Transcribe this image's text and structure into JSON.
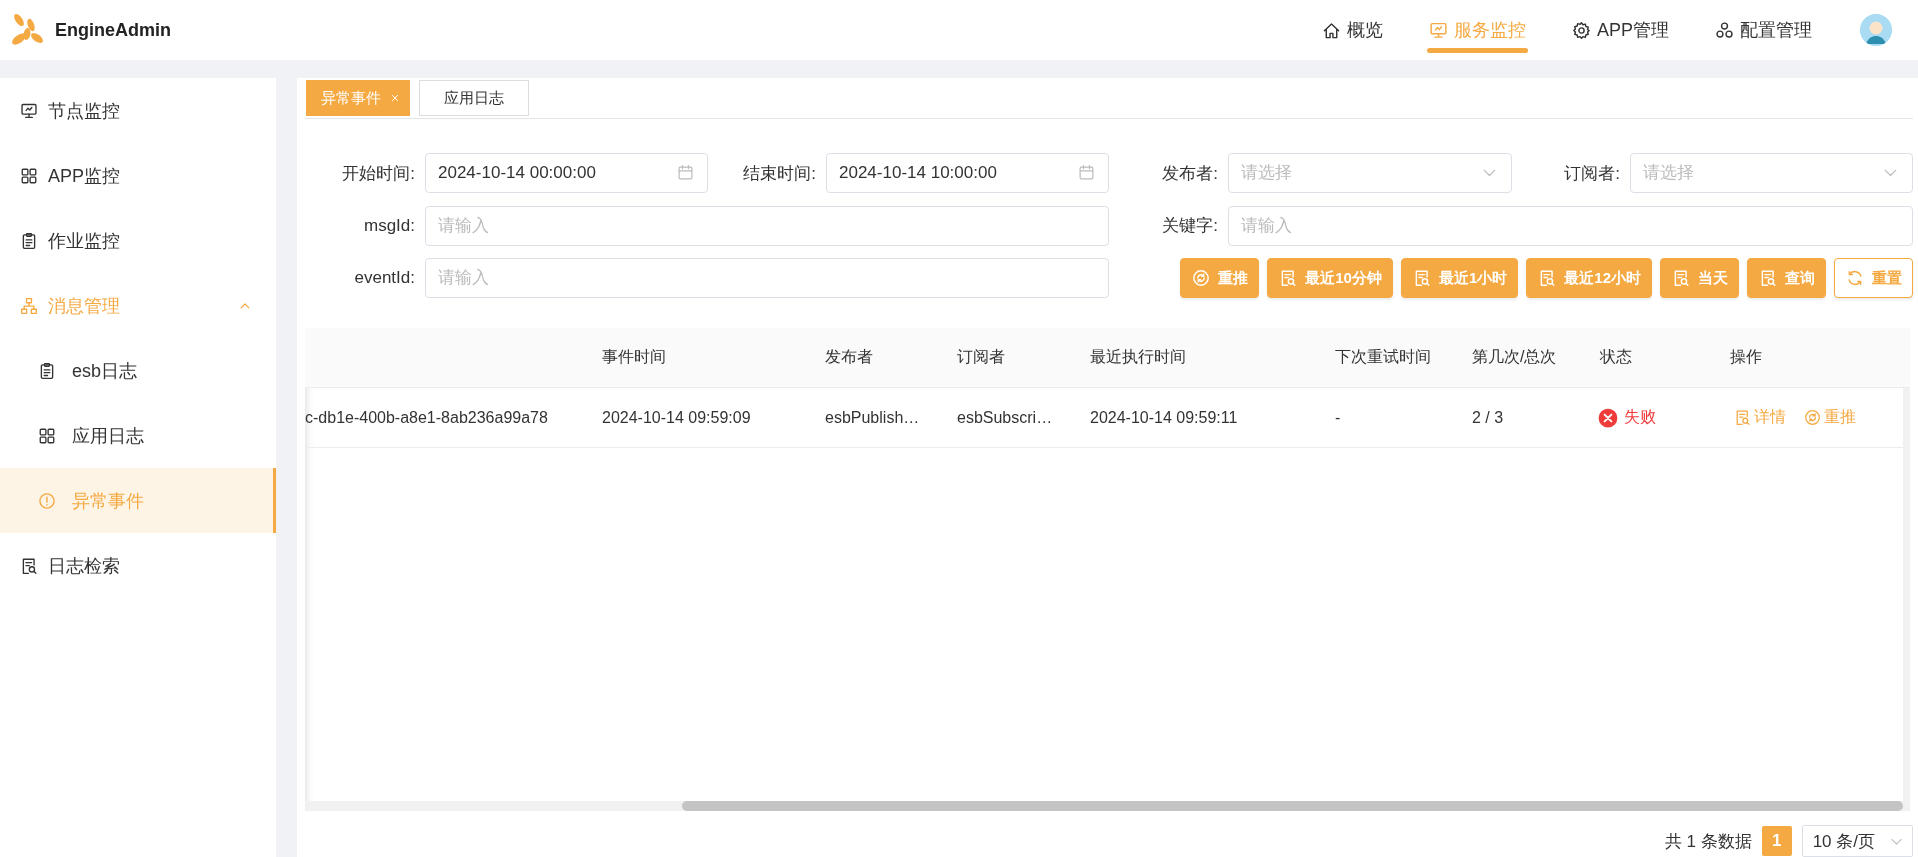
{
  "app": {
    "title": "EngineAdmin"
  },
  "nav": [
    {
      "label": "概览",
      "selected": false
    },
    {
      "label": "服务监控",
      "selected": true
    },
    {
      "label": "APP管理",
      "selected": false
    },
    {
      "label": "配置管理",
      "selected": false
    }
  ],
  "sidebar": {
    "items": [
      {
        "label": "节点监控",
        "selected": false
      },
      {
        "label": "APP监控",
        "selected": false
      },
      {
        "label": "作业监控",
        "selected": false
      },
      {
        "label": "消息管理",
        "expanded": true,
        "children": [
          {
            "label": "esb日志",
            "selected": false
          },
          {
            "label": "应用日志",
            "selected": false
          },
          {
            "label": "异常事件",
            "selected": true
          }
        ]
      },
      {
        "label": "日志检索",
        "selected": false
      }
    ]
  },
  "tabs": [
    {
      "label": "异常事件",
      "selected": true,
      "closable": true
    },
    {
      "label": "应用日志",
      "selected": false,
      "closable": false
    }
  ],
  "filters": [
    {
      "label": "开始时间:",
      "kind": "date",
      "value": "2024-10-14 00:00:00"
    },
    {
      "label": "结束时间:",
      "kind": "date",
      "value": "2024-10-14 10:00:00"
    },
    {
      "label": "发布者:",
      "kind": "select",
      "placeholder": "请选择"
    },
    {
      "label": "订阅者:",
      "kind": "select",
      "placeholder": "请选择"
    },
    {
      "label": "msgId:",
      "kind": "text",
      "placeholder": "请输入"
    },
    {
      "label": "关键字:",
      "kind": "text",
      "placeholder": "请输入"
    },
    {
      "label": "eventId:",
      "kind": "text",
      "placeholder": "请输入"
    }
  ],
  "buttons": [
    {
      "label": "重推",
      "kind": "primary"
    },
    {
      "label": "最近10分钟",
      "kind": "primary"
    },
    {
      "label": "最近1小时",
      "kind": "primary"
    },
    {
      "label": "最近12小时",
      "kind": "primary"
    },
    {
      "label": "当天",
      "kind": "primary"
    },
    {
      "label": "查询",
      "kind": "primary"
    },
    {
      "label": "重置",
      "kind": "outline"
    }
  ],
  "table": {
    "columns": [
      "",
      "事件时间",
      "发布者",
      "订阅者",
      "最近执行时间",
      "下次重试时间",
      "第几次/总次",
      "状态",
      "操作"
    ],
    "rows": [
      {
        "cells": [
          "c-db1e-400b-a8e1-8ab236a99a78",
          "2024-10-14 09:59:09",
          "esbPublish…",
          "esbSubscri…",
          "2024-10-14 09:59:11",
          "-",
          "2 / 3"
        ],
        "status": {
          "label": "失败",
          "kind": "failed"
        },
        "actions": [
          {
            "label": "详情"
          },
          {
            "label": "重推"
          }
        ]
      }
    ]
  },
  "pagination": {
    "summary": "共 1 条数据",
    "pages": [
      {
        "label": "1",
        "selected": true
      }
    ],
    "page_size": "10 条/页"
  }
}
